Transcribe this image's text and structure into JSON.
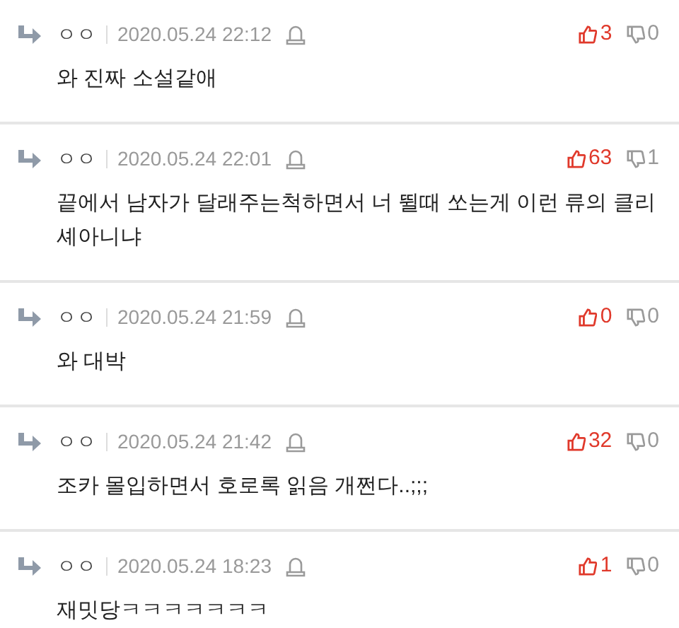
{
  "comments": [
    {
      "author": "ㅇㅇ",
      "date": "2020.05.24 22:12",
      "likes": "3",
      "dislikes": "0",
      "text": "와 진짜 소설같애"
    },
    {
      "author": "ㅇㅇ",
      "date": "2020.05.24 22:01",
      "likes": "63",
      "dislikes": "1",
      "text": "끝에서 남자가 달래주는척하면서 너 뛸때 쏘는게 이런 류의 클리셰아니냐"
    },
    {
      "author": "ㅇㅇ",
      "date": "2020.05.24 21:59",
      "likes": "0",
      "dislikes": "0",
      "text": "와 대박"
    },
    {
      "author": "ㅇㅇ",
      "date": "2020.05.24 21:42",
      "likes": "32",
      "dislikes": "0",
      "text": "조카 몰입하면서 호로록 읽음 개쩐다..;;;"
    },
    {
      "author": "ㅇㅇ",
      "date": "2020.05.24 18:23",
      "likes": "1",
      "dislikes": "0",
      "text": "재밋당ㅋㅋㅋㅋㅋㅋㅋ"
    }
  ]
}
